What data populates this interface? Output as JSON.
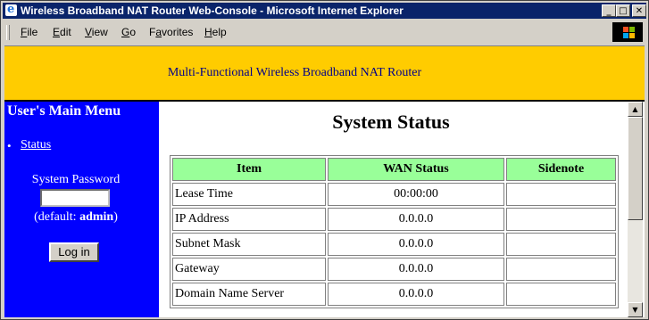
{
  "window": {
    "title": "Wireless Broadband NAT Router Web-Console - Microsoft Internet Explorer",
    "min_glyph": "_",
    "max_glyph": "□",
    "close_glyph": "✕"
  },
  "menubar": {
    "items": [
      {
        "key": "F",
        "rest": "ile"
      },
      {
        "key": "E",
        "rest": "dit"
      },
      {
        "key": "V",
        "rest": "iew"
      },
      {
        "key": "G",
        "rest": "o"
      },
      {
        "key": "a",
        "pre": "F",
        "rest": "vorites"
      },
      {
        "key": "H",
        "rest": "elp"
      }
    ]
  },
  "banner": {
    "text": "Multi-Functional Wireless Broadband NAT Router"
  },
  "sidebar": {
    "heading": "User's Main Menu",
    "bullet": "•",
    "status_link": "Status",
    "password_label": "System Password",
    "default_prefix": "(default: ",
    "default_value": "admin",
    "default_suffix": ")",
    "login_label": "Log in"
  },
  "main": {
    "title": "System Status",
    "table": {
      "headers": [
        "Item",
        "WAN Status",
        "Sidenote"
      ],
      "rows": [
        [
          "Lease Time",
          "00:00:00",
          ""
        ],
        [
          "IP Address",
          "0.0.0.0",
          ""
        ],
        [
          "Subnet Mask",
          "0.0.0.0",
          ""
        ],
        [
          "Gateway",
          "0.0.0.0",
          ""
        ],
        [
          "Domain Name Server",
          "0.0.0.0",
          ""
        ]
      ]
    }
  },
  "scrollbar": {
    "up_glyph": "▲",
    "down_glyph": "▼"
  },
  "colors": {
    "titlebar": "#0a246a",
    "banner": "#ffcc00",
    "banner_text": "#00008b",
    "sidebar": "#0000ff",
    "table_header": "#99ff99"
  }
}
